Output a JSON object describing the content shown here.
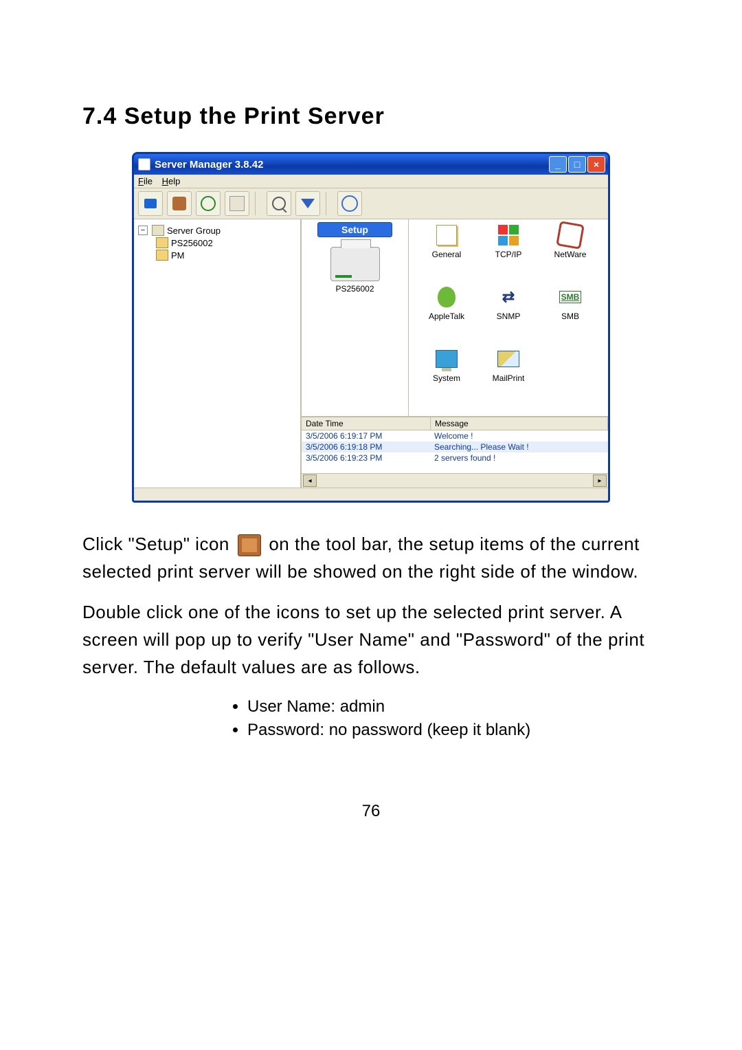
{
  "heading": "7.4    Setup the Print Server",
  "window": {
    "title": "Server Manager 3.8.42",
    "menu": {
      "file": "File",
      "help": "Help"
    },
    "toolbar_icons": {
      "status": "status-icon",
      "setup": "setup-icon",
      "refresh": "refresh-icon",
      "reboot": "reboot-icon",
      "search": "search-icon",
      "dlarrow": "download-icon",
      "ip": "ip-icon"
    },
    "tree": {
      "root": "Server Group",
      "children": [
        "PS256002",
        "PM"
      ]
    },
    "setup": {
      "button": "Setup",
      "server_name": "PS256002",
      "items": {
        "general": "General",
        "tcpip": "TCP/IP",
        "netware": "NetWare",
        "appletalk": "AppleTalk",
        "snmp": "SNMP",
        "smb": "SMB",
        "system": "System",
        "mailprint": "MailPrint"
      }
    },
    "log": {
      "cols": {
        "dt": "Date Time",
        "msg": "Message"
      },
      "rows": [
        {
          "dt": "3/5/2006 6:19:17 PM",
          "msg": "Welcome !"
        },
        {
          "dt": "3/5/2006 6:19:18 PM",
          "msg": "Searching... Please Wait !"
        },
        {
          "dt": "3/5/2006 6:19:23 PM",
          "msg": "2 servers found !"
        }
      ]
    }
  },
  "para1a": "Click \"Setup\" icon ",
  "para1b": " on the tool bar, the setup items of the current selected print server will be showed on the right side of the window.",
  "para2": "Double click one of the icons to set up the selected print server. A screen will pop up to verify \"User Name\" and \"Password\" of the print server. The default values are as follows.",
  "creds": {
    "user": "User Name: admin",
    "pass": "Password: no password (keep it blank)"
  },
  "page_number": "76"
}
